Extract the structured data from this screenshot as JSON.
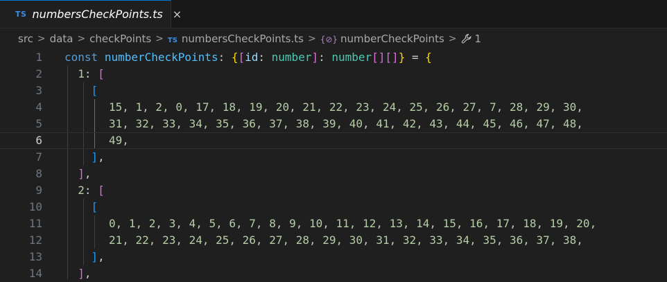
{
  "tab": {
    "icon": "TS",
    "title": "numbersCheckPoints.ts",
    "close_glyph": "×"
  },
  "breadcrumb": {
    "items": [
      "src",
      "data",
      "checkPoints",
      "numbersCheckPoints.ts",
      "numberCheckPoints",
      "1"
    ],
    "ts_icon": "TS",
    "symbol_icon": "{⊘}",
    "separator": ">"
  },
  "editor": {
    "current_line": 6,
    "line_numbers": [
      "1",
      "2",
      "3",
      "4",
      "5",
      "6",
      "7",
      "8",
      "9",
      "10",
      "11",
      "12",
      "13",
      "14"
    ],
    "lines": {
      "l1": {
        "const": "const",
        "name": "numberCheckPoints",
        "colon": ": ",
        "b_open": "{",
        "sq_open": "[",
        "id": "id",
        "colon2": ": ",
        "t1": "number",
        "sq_close": "]",
        "colon3": ": ",
        "t2": "number",
        "arr": "[][]",
        "b_close": "}",
        "eq": " = ",
        "b_open2": "{"
      },
      "l2": {
        "key": "1",
        "colon": ": ",
        "open": "["
      },
      "l3": {
        "open": "["
      },
      "l4": {
        "nums": "15, 1, 2, 0, 17, 18, 19, 20, 21, 22, 23, 24, 25, 26, 27, 7, 28, 29, 30,"
      },
      "l5": {
        "nums": "31, 32, 33, 34, 35, 36, 37, 38, 39, 40, 41, 42, 43, 44, 45, 46, 47, 48,"
      },
      "l6": {
        "nums": "49,"
      },
      "l7": {
        "close": "]",
        "comma": ","
      },
      "l8": {
        "close": "]",
        "comma": ","
      },
      "l9": {
        "key": "2",
        "colon": ": ",
        "open": "["
      },
      "l10": {
        "open": "["
      },
      "l11": {
        "nums": "0, 1, 2, 3, 4, 5, 6, 7, 8, 9, 10, 11, 12, 13, 14, 15, 16, 17, 18, 19, 20,"
      },
      "l12": {
        "nums": "21, 22, 23, 24, 25, 26, 27, 28, 29, 30, 31, 32, 33, 34, 35, 36, 37, 38,"
      },
      "l13": {
        "close": "]",
        "comma": ","
      },
      "l14": {
        "close": "]",
        "comma": ","
      }
    }
  },
  "colors": {
    "background": "#1f1f1f",
    "keyword": "#569cd6",
    "variable": "#4fc1ff",
    "type": "#4ec9b0",
    "number": "#b5cea8",
    "bracket_gold": "#ffd700",
    "bracket_pink": "#da70d6",
    "bracket_blue": "#179fff"
  }
}
